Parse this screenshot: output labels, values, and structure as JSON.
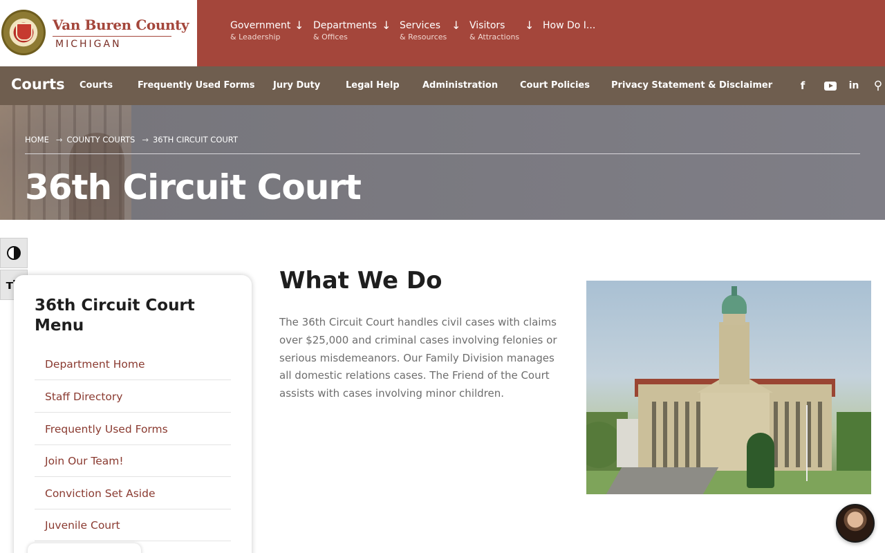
{
  "header": {
    "county_name": "Van Buren County",
    "state": "MICHIGAN",
    "nav": [
      {
        "label": "Government",
        "sub": "& Leadership",
        "arrow": "↓"
      },
      {
        "label": "Departments",
        "sub": "& Offices",
        "arrow": "↓"
      },
      {
        "label": "Services",
        "sub": "& Resources",
        "arrow": "↓"
      },
      {
        "label": "Visitors",
        "sub": "& Attractions",
        "arrow": "↓"
      },
      {
        "label": "How Do I...",
        "sub": "",
        "arrow": ""
      }
    ]
  },
  "subnav": {
    "title": "Courts",
    "items": [
      "Courts",
      "Frequently Used Forms",
      "Jury Duty",
      "Legal Help",
      "Administration",
      "Court Policies",
      "Privacy Statement & Disclaimer"
    ],
    "social": {
      "facebook": "f",
      "linkedin": "in",
      "search": "⚲"
    }
  },
  "hero": {
    "breadcrumb": [
      "HOME",
      "COUNTY COURTS",
      "36TH CIRCUIT COURT"
    ],
    "arrow": "→",
    "title": "36th Circuit Court"
  },
  "accessibility": {
    "text_size_icon": "ᴛT"
  },
  "sidemenu": {
    "heading": "36th Circuit Court Menu",
    "items": [
      "Department Home",
      "Staff Directory",
      "Frequently Used Forms",
      "Join Our Team!",
      "Conviction Set Aside",
      "Juvenile Court"
    ]
  },
  "main": {
    "heading": "What We Do",
    "body": "The 36th Circuit Court handles civil cases with claims over $25,000 and criminal cases involving felonies or serious misdemeanors. Our Family Division manages all domestic relations cases. The Friend of the Court assists with cases involving minor children."
  },
  "colors": {
    "brand_red": "#a4463b",
    "subnav_brown": "#6f5e4f",
    "link_red": "#8a3a30"
  }
}
